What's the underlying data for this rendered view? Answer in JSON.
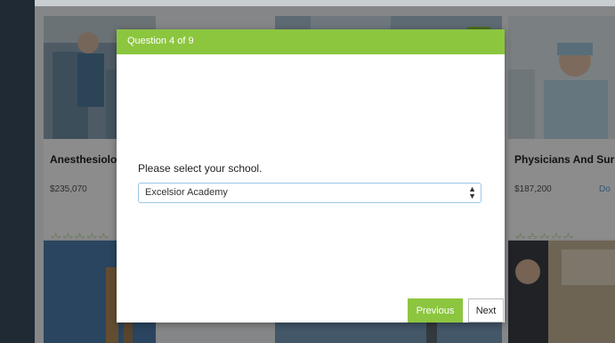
{
  "modal": {
    "header_title": "Question 4 of 9",
    "question": "Please select your school.",
    "school_select": {
      "selected": "Excelsior Academy"
    },
    "previous_label": "Previous",
    "next_label": "Next"
  },
  "cards": [
    {
      "title": "Anesthesiolo",
      "salary": "$235,070",
      "stars": "☆☆☆☆☆",
      "badge": "☼"
    },
    {
      "badge": "☼"
    },
    {
      "title": "Physicians And Sur",
      "salary": "$187,200",
      "link": "Do",
      "stars": "☆☆☆☆☆"
    }
  ],
  "colors": {
    "accent_green": "#8cc63f",
    "sidebar": "#1f2a34",
    "select_border": "#9bc7e6"
  }
}
